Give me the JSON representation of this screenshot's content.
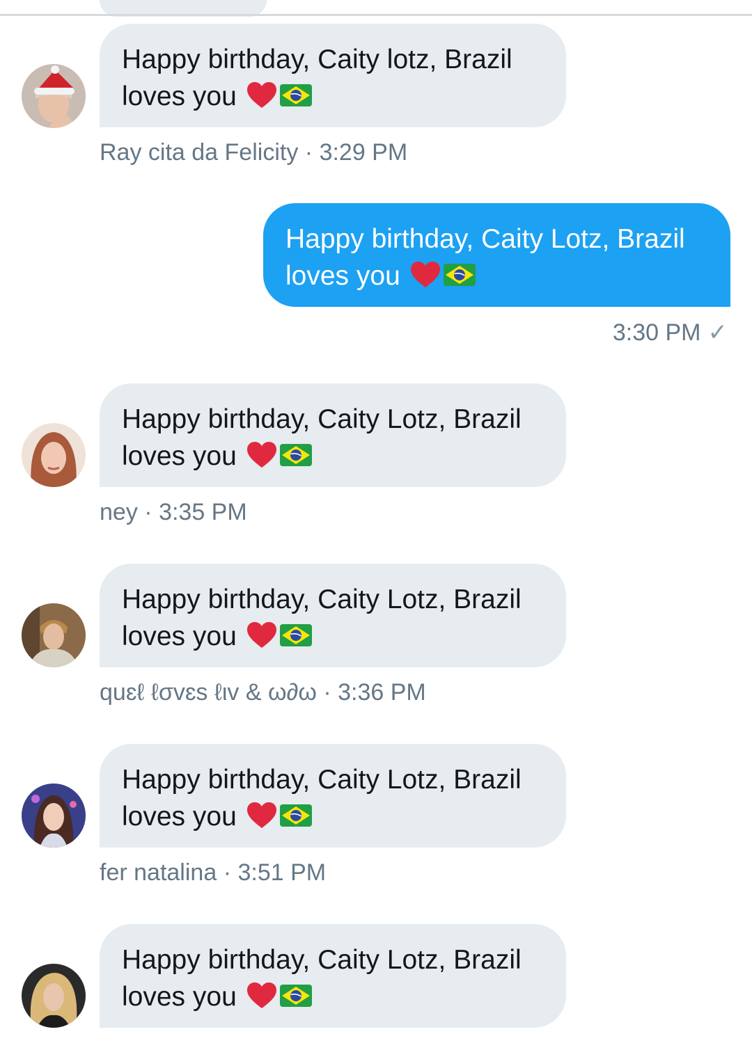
{
  "colors": {
    "incoming_bubble": "#e6ecf0",
    "outgoing_bubble": "#1da1f2",
    "meta_text": "#657786",
    "heart": "#e0293f"
  },
  "messages": [
    {
      "direction": "incoming",
      "line1": "Happy birthday, Caity lotz, Brazil",
      "line2": "loves you",
      "emoji": [
        "red-heart-icon",
        "brazil-flag-icon"
      ],
      "sender": "Ray cita da Felicity",
      "separator": "·",
      "time": "3:29 PM"
    },
    {
      "direction": "outgoing",
      "line1": "Happy birthday, Caity Lotz, Brazil",
      "line2": "loves you",
      "emoji": [
        "red-heart-icon",
        "brazil-flag-icon"
      ],
      "time": "3:30 PM",
      "status": "✓"
    },
    {
      "direction": "incoming",
      "line1": "Happy birthday, Caity Lotz, Brazil",
      "line2": "loves you",
      "emoji": [
        "red-heart-icon",
        "brazil-flag-icon"
      ],
      "sender": "ney",
      "separator": "·",
      "time": "3:35 PM"
    },
    {
      "direction": "incoming",
      "line1": "Happy birthday, Caity Lotz, Brazil",
      "line2": "loves you",
      "emoji": [
        "red-heart-icon",
        "brazil-flag-icon"
      ],
      "sender": "quɛℓ ℓσvɛs ℓιv & ω∂ω",
      "separator": "·",
      "time": "3:36 PM"
    },
    {
      "direction": "incoming",
      "line1": "Happy birthday, Caity Lotz, Brazil",
      "line2": "loves you",
      "emoji": [
        "red-heart-icon",
        "brazil-flag-icon"
      ],
      "sender": "fer natalina",
      "separator": "·",
      "time": "3:51 PM"
    },
    {
      "direction": "incoming",
      "line1": "Happy birthday, Caity Lotz, Brazil",
      "line2": "loves you",
      "emoji": [
        "red-heart-icon",
        "brazil-flag-icon"
      ]
    }
  ]
}
